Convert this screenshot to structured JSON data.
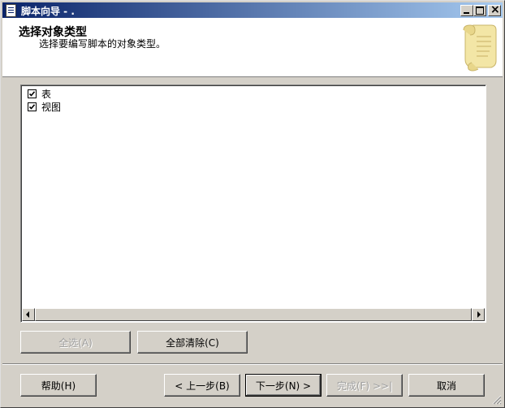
{
  "window": {
    "title": "脚本向导 - ."
  },
  "header": {
    "title": "选择对象类型",
    "subtitle": "选择要编写脚本的对象类型。",
    "icon": "scroll-icon"
  },
  "object_types": [
    {
      "label": "表",
      "checked": true
    },
    {
      "label": "视图",
      "checked": true
    }
  ],
  "buttons": {
    "select_all": "全选(A)",
    "clear_all": "全部清除(C)",
    "help": "帮助(H)",
    "back": "< 上一步(B)",
    "next": "下一步(N) >",
    "finish": "完成(F) >>|",
    "cancel": "取消"
  },
  "colors": {
    "titlebar_start": "#0a246a",
    "titlebar_end": "#a6caf0",
    "face": "#d4d0c8"
  }
}
